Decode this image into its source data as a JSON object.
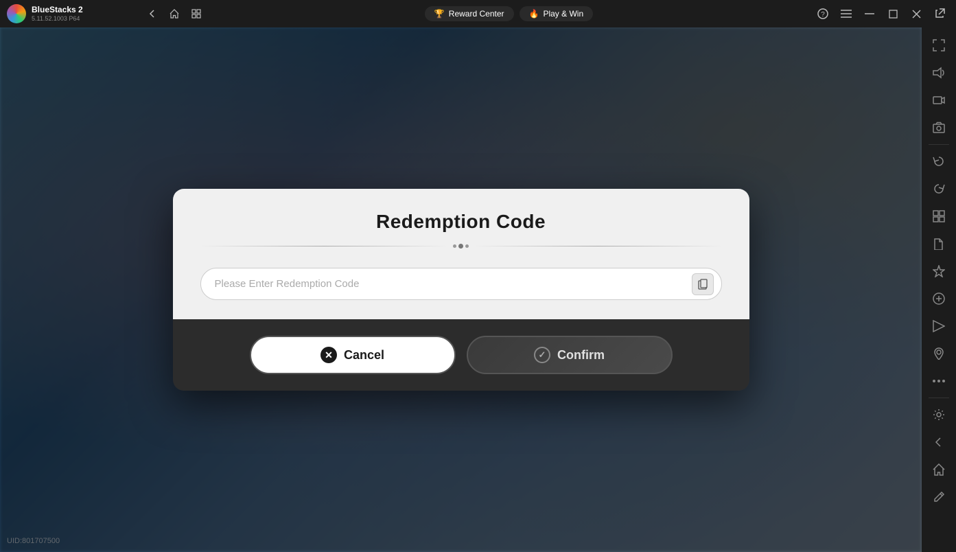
{
  "app": {
    "title": "BlueStacks 2",
    "version": "5.11.52.1003  P64",
    "uid": "UID:801707500"
  },
  "topbar": {
    "back_label": "←",
    "home_label": "⌂",
    "tabs_label": "▣",
    "reward_center_label": "Reward Center",
    "play_win_label": "Play & Win",
    "help_icon": "?",
    "menu_icon": "≡",
    "minimize_icon": "─",
    "restore_icon": "□",
    "close_icon": "✕",
    "expand_icon": "⇔"
  },
  "sidebar": {
    "icons": [
      "⛶",
      "🔊",
      "▶",
      "⬛",
      "↺",
      "↻",
      "⚙",
      "📁",
      "✈",
      "⊕",
      "◈",
      "⊙",
      "⋯",
      "⚙",
      "←",
      "⌂",
      "🖊"
    ]
  },
  "dialog": {
    "title": "Redemption Code",
    "input_placeholder": "Please Enter Redemption Code",
    "cancel_label": "Cancel",
    "confirm_label": "Confirm"
  }
}
